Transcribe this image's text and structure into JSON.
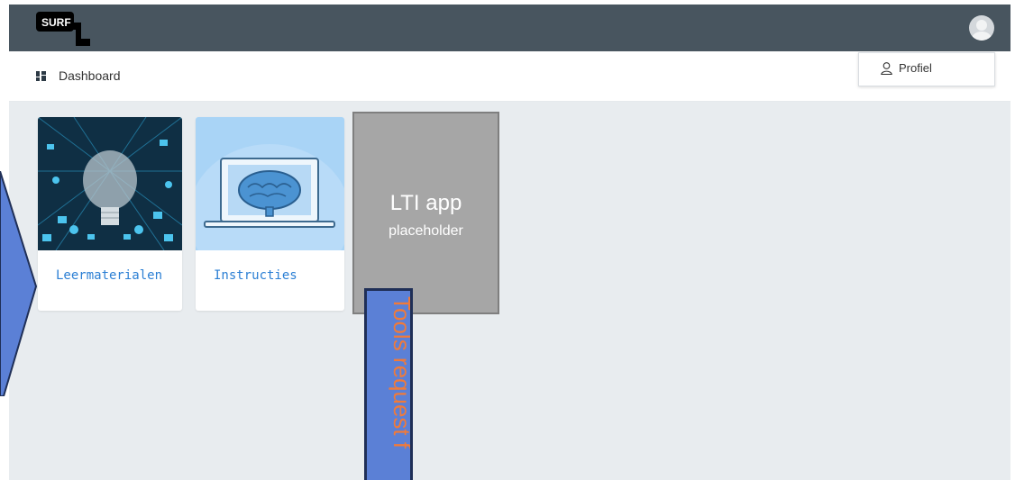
{
  "header": {
    "logo_text": "SURF",
    "avatar_icon": "user-avatar-icon"
  },
  "subheader": {
    "dashboard_label": "Dashboard",
    "dashboard_icon": "grid-icon"
  },
  "profile_menu": {
    "item_label": "Profiel",
    "item_icon": "user-icon"
  },
  "cards": [
    {
      "title": "Leermaterialen",
      "image": "lightbulb-illustration"
    },
    {
      "title": "Instructies",
      "image": "laptop-brain-illustration"
    }
  ],
  "lti_placeholder": {
    "line1": "LTI app",
    "line2": "placeholder"
  },
  "annotation": {
    "text": "Tools request f"
  },
  "colors": {
    "topbar": "#48555f",
    "main_bg": "#e8ecef",
    "link_blue": "#2b7fd4",
    "annotation_fill": "#5b80d6",
    "annotation_text": "#f07a3a"
  }
}
